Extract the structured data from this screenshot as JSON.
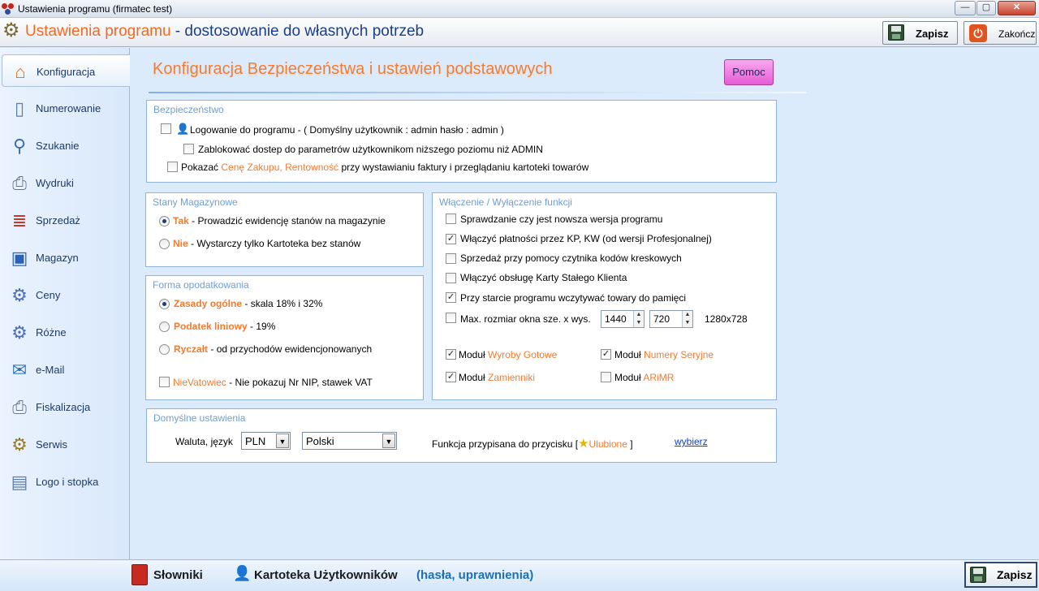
{
  "window": {
    "title": "Ustawienia programu (firmatec test)",
    "controls": {
      "minimize": "—",
      "maximize": "▢",
      "close": "✕"
    }
  },
  "header": {
    "title_part1": "Ustawienia programu",
    "title_sep": " - ",
    "title_part2": "dostosowanie do własnych potrzeb",
    "save_label": "Zapisz",
    "exit_label": "Zakończ"
  },
  "sidebar": {
    "items": [
      {
        "label": "Konfiguracja",
        "icon": "house-icon"
      },
      {
        "label": "Numerowanie",
        "icon": "document-icon"
      },
      {
        "label": "Szukanie",
        "icon": "magnifier-icon"
      },
      {
        "label": "Wydruki",
        "icon": "printer-icon"
      },
      {
        "label": "Sprzedaż",
        "icon": "invoice-icon"
      },
      {
        "label": "Magazyn",
        "icon": "warehouse-icon"
      },
      {
        "label": "Ceny",
        "icon": "cog-icon"
      },
      {
        "label": "Różne",
        "icon": "cog-icon"
      },
      {
        "label": "e-Mail",
        "icon": "mail-icon"
      },
      {
        "label": "Fiskalizacja",
        "icon": "fiscal-printer-icon"
      },
      {
        "label": "Serwis",
        "icon": "gears-icon"
      },
      {
        "label": "Logo i stopka",
        "icon": "notepad-icon"
      }
    ],
    "active_index": 0
  },
  "main": {
    "page_title": "Konfiguracja Bezpieczeństwa i ustawień podstawowych",
    "help_label": "Pomoc",
    "security": {
      "title": "Bezpieczeństwo",
      "login_label": "Logowanie do programu - ( Domyślny użytkownik : admin     hasło : admin )",
      "login_checked": false,
      "block_label": "Zablokować dostep do parametrów użytkownikom niższego poziomu niż ADMIN",
      "block_checked": false,
      "show_prefix": "Pokazać ",
      "show_highlight": "Cenę Zakupu, Rentowność",
      "show_suffix": " przy wystawianiu faktury i przeglądaniu kartoteki towarów",
      "show_checked": false
    },
    "stock": {
      "title": "Stany Magazynowe",
      "opt1_key": "Tak",
      "opt1_text": " - Prowadzić ewidencję stanów na magazynie",
      "opt2_key": "Nie",
      "opt2_text": " - Wystarczy tylko Kartoteka bez stanów",
      "selected": "Tak"
    },
    "tax": {
      "title": "Forma opodatkowania",
      "opt1_key": "Zasady ogólne",
      "opt1_text": " - skala 18% i 32%",
      "opt2_key": "Podatek liniowy",
      "opt2_text": " - 19%",
      "opt3_key": "Ryczałt",
      "opt3_text": " - od przychodów ewidencjonowanych",
      "selected": "Zasady ogólne",
      "nonvat_key": "NieVatowiec",
      "nonvat_text": " - Nie pokazuj Nr NIP, stawek VAT",
      "nonvat_checked": false
    },
    "functions": {
      "title": "Włączenie / Wyłączenie funkcji",
      "items": [
        {
          "label": "Sprawdzanie czy jest nowsza wersja programu",
          "checked": false
        },
        {
          "label": "Włączyć płatności przez KP, KW (od wersji Profesjonalnej)",
          "checked": true
        },
        {
          "label": "Sprzedaż przy pomocy czytnika kodów kreskowych",
          "checked": false
        },
        {
          "label": "Włączyć obsługę Karty Stałego Klienta",
          "checked": false
        },
        {
          "label": "Przy starcie programu wczytywać towary do pamięci",
          "checked": true
        },
        {
          "label": "Max. rozmiar okna sze. x wys.",
          "checked": false
        }
      ],
      "width_value": "1440",
      "height_value": "720",
      "resolution": "1280x728",
      "module_prefix": "Moduł ",
      "modules": [
        {
          "name": "Wyroby Gotowe",
          "checked": true
        },
        {
          "name": "Numery Seryjne",
          "checked": true
        },
        {
          "name": "Zamienniki",
          "checked": true
        },
        {
          "name": "ARiMR",
          "checked": false
        }
      ]
    },
    "defaults": {
      "title": "Domyślne ustawienia",
      "currency_label": "Waluta, język",
      "currency_value": "PLN",
      "language_value": "Polski",
      "fav_prefix": "Funkcja przypisana do przycisku  [",
      "fav_name": "Ulubione",
      "fav_suffix": " ]",
      "choose_link": "wybierz"
    }
  },
  "bottom": {
    "dictionaries_label": "Słowniki",
    "users_label": "Kartoteka Użytkowników",
    "users_extra": "(hasła, uprawnienia)",
    "save_label": "Zapisz"
  },
  "colors": {
    "accent": "#f47b2f",
    "navy": "#1b3f86",
    "help_button": "#e65bd6",
    "link": "#1a3fb8"
  }
}
